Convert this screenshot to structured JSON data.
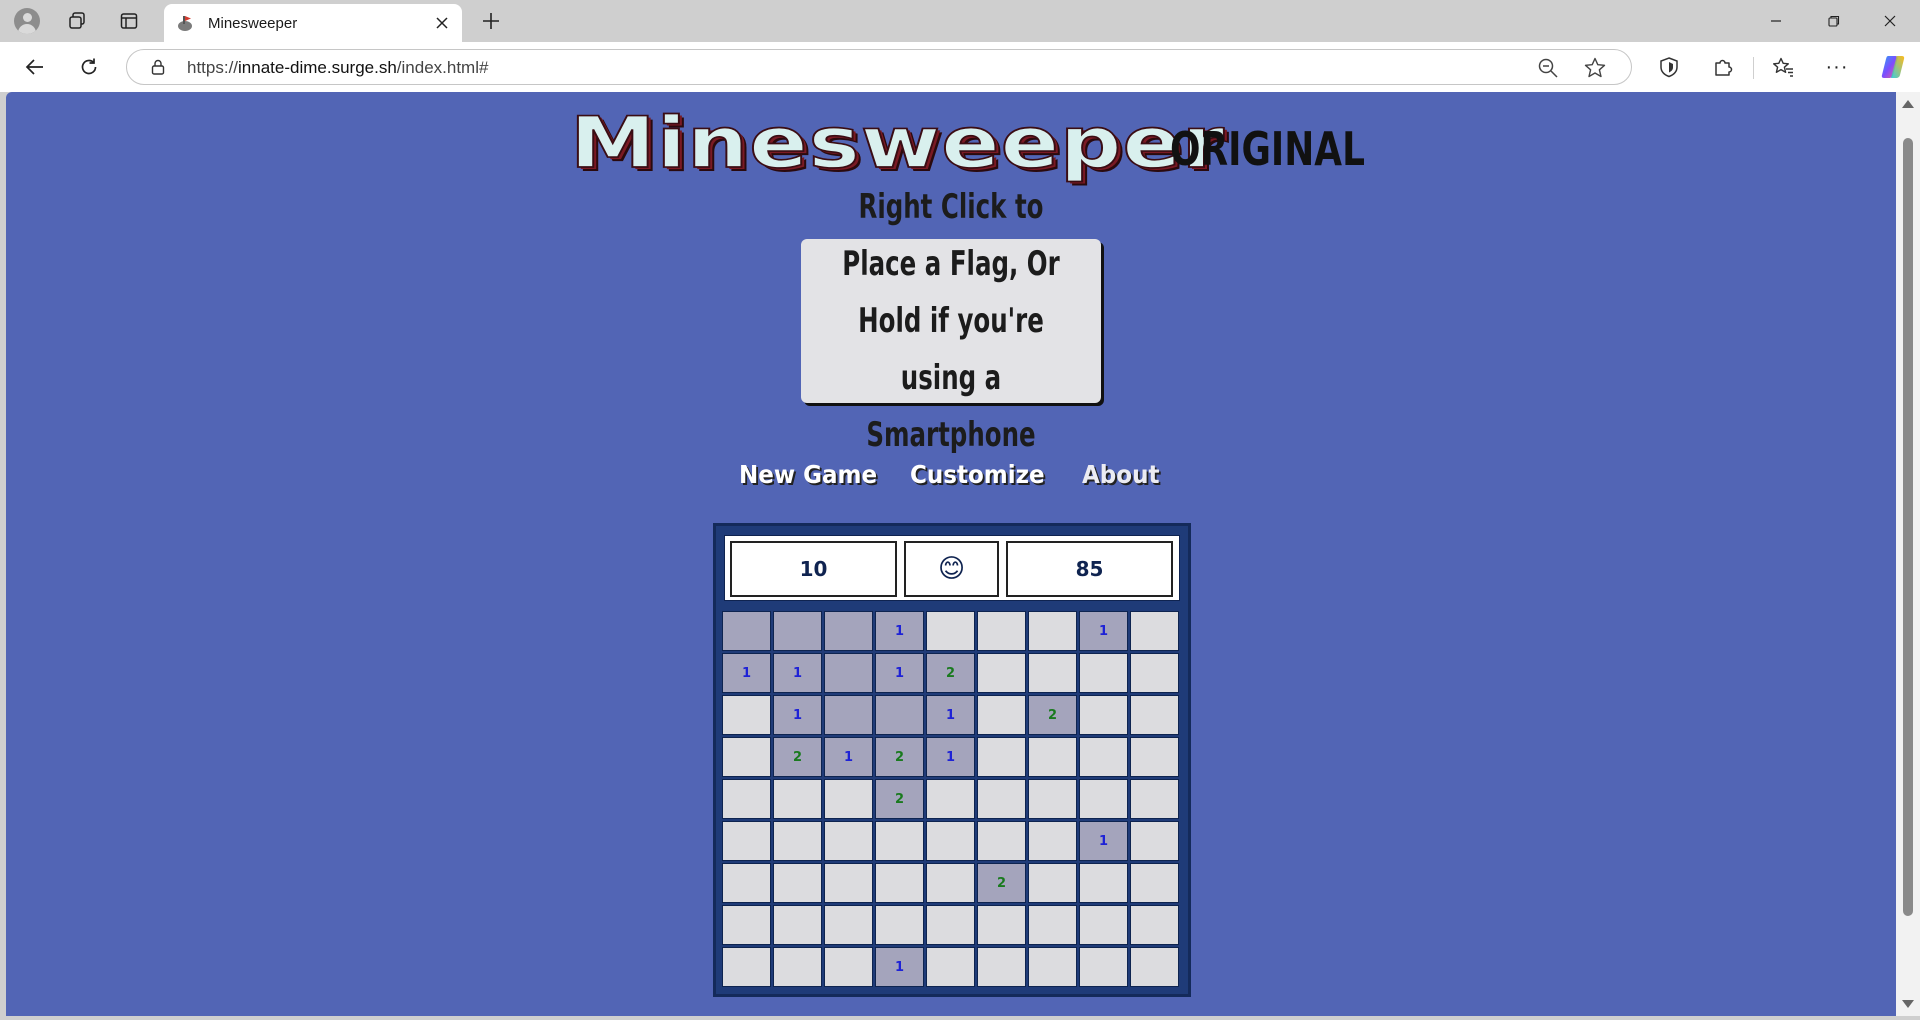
{
  "browser": {
    "tab_title": "Minesweeper",
    "url_prefix": "https://",
    "url_host": "innate-dime.surge.sh",
    "url_path": "/index.html#",
    "more_label": "···"
  },
  "header": {
    "title": "Minesweeper",
    "subtitle": "ORIGINAL"
  },
  "hint": {
    "text": "Right Click to Place a Flag, Or Hold if you're using a Smartphone"
  },
  "nav": {
    "new_game": "New Game",
    "customize": "Customize",
    "about": "About"
  },
  "game": {
    "mines_remaining": "10",
    "face": "😊",
    "timer": "85",
    "rows": [
      [
        {
          "s": "open",
          "v": ""
        },
        {
          "s": "open",
          "v": ""
        },
        {
          "s": "open",
          "v": ""
        },
        {
          "s": "open",
          "v": "1"
        },
        {
          "s": "hidden",
          "v": ""
        },
        {
          "s": "hidden",
          "v": ""
        },
        {
          "s": "hidden",
          "v": ""
        },
        {
          "s": "open",
          "v": "1"
        },
        {
          "s": "hidden",
          "v": ""
        }
      ],
      [
        {
          "s": "open",
          "v": "1"
        },
        {
          "s": "open",
          "v": "1"
        },
        {
          "s": "open",
          "v": ""
        },
        {
          "s": "open",
          "v": "1"
        },
        {
          "s": "open",
          "v": "2"
        },
        {
          "s": "hidden",
          "v": ""
        },
        {
          "s": "hidden",
          "v": ""
        },
        {
          "s": "hidden",
          "v": ""
        },
        {
          "s": "hidden",
          "v": ""
        }
      ],
      [
        {
          "s": "hidden",
          "v": ""
        },
        {
          "s": "open",
          "v": "1"
        },
        {
          "s": "open",
          "v": ""
        },
        {
          "s": "open",
          "v": ""
        },
        {
          "s": "open",
          "v": "1"
        },
        {
          "s": "hidden",
          "v": ""
        },
        {
          "s": "open",
          "v": "2"
        },
        {
          "s": "hidden",
          "v": ""
        },
        {
          "s": "hidden",
          "v": ""
        }
      ],
      [
        {
          "s": "hidden",
          "v": ""
        },
        {
          "s": "open",
          "v": "2"
        },
        {
          "s": "open",
          "v": "1"
        },
        {
          "s": "open",
          "v": "2"
        },
        {
          "s": "open",
          "v": "1"
        },
        {
          "s": "hidden",
          "v": ""
        },
        {
          "s": "hidden",
          "v": ""
        },
        {
          "s": "hidden",
          "v": ""
        },
        {
          "s": "hidden",
          "v": ""
        }
      ],
      [
        {
          "s": "hidden",
          "v": ""
        },
        {
          "s": "hidden",
          "v": ""
        },
        {
          "s": "hidden",
          "v": ""
        },
        {
          "s": "open",
          "v": "2"
        },
        {
          "s": "hidden",
          "v": ""
        },
        {
          "s": "hidden",
          "v": ""
        },
        {
          "s": "hidden",
          "v": ""
        },
        {
          "s": "hidden",
          "v": ""
        },
        {
          "s": "hidden",
          "v": ""
        }
      ],
      [
        {
          "s": "hidden",
          "v": ""
        },
        {
          "s": "hidden",
          "v": ""
        },
        {
          "s": "hidden",
          "v": ""
        },
        {
          "s": "hidden",
          "v": ""
        },
        {
          "s": "hidden",
          "v": ""
        },
        {
          "s": "hidden",
          "v": ""
        },
        {
          "s": "hidden",
          "v": ""
        },
        {
          "s": "open",
          "v": "1"
        },
        {
          "s": "hidden",
          "v": ""
        }
      ],
      [
        {
          "s": "hidden",
          "v": ""
        },
        {
          "s": "hidden",
          "v": ""
        },
        {
          "s": "hidden",
          "v": ""
        },
        {
          "s": "hidden",
          "v": ""
        },
        {
          "s": "hidden",
          "v": ""
        },
        {
          "s": "open",
          "v": "2"
        },
        {
          "s": "hidden",
          "v": ""
        },
        {
          "s": "hidden",
          "v": ""
        },
        {
          "s": "hidden",
          "v": ""
        }
      ],
      [
        {
          "s": "hidden",
          "v": ""
        },
        {
          "s": "hidden",
          "v": ""
        },
        {
          "s": "hidden",
          "v": ""
        },
        {
          "s": "hidden",
          "v": ""
        },
        {
          "s": "hidden",
          "v": ""
        },
        {
          "s": "hidden",
          "v": ""
        },
        {
          "s": "hidden",
          "v": ""
        },
        {
          "s": "hidden",
          "v": ""
        },
        {
          "s": "hidden",
          "v": ""
        }
      ],
      [
        {
          "s": "hidden",
          "v": ""
        },
        {
          "s": "hidden",
          "v": ""
        },
        {
          "s": "hidden",
          "v": ""
        },
        {
          "s": "open",
          "v": "1"
        },
        {
          "s": "hidden",
          "v": ""
        },
        {
          "s": "hidden",
          "v": ""
        },
        {
          "s": "hidden",
          "v": ""
        },
        {
          "s": "hidden",
          "v": ""
        },
        {
          "s": "hidden",
          "v": ""
        }
      ]
    ]
  },
  "colors": {
    "page_background": "#5265b5",
    "board_frame": "#1f3b78",
    "cell_hidden": "#dcdcdf",
    "cell_open": "#a4a4bc",
    "number_1": "#1e22d6",
    "number_2": "#197a1e"
  },
  "icons": {
    "profile": "person-avatar-icon",
    "workspaces": "workspaces-icon",
    "tab_actions": "vertical-tabs-icon",
    "favicon": "minesweeper-favicon",
    "lock": "lock-icon",
    "zoom": "zoom-out-icon",
    "favorite": "star-icon",
    "shield": "browser-essentials-icon",
    "extensions": "puzzle-icon",
    "favorites_list": "favorites-icon",
    "copilot": "copilot-icon"
  }
}
